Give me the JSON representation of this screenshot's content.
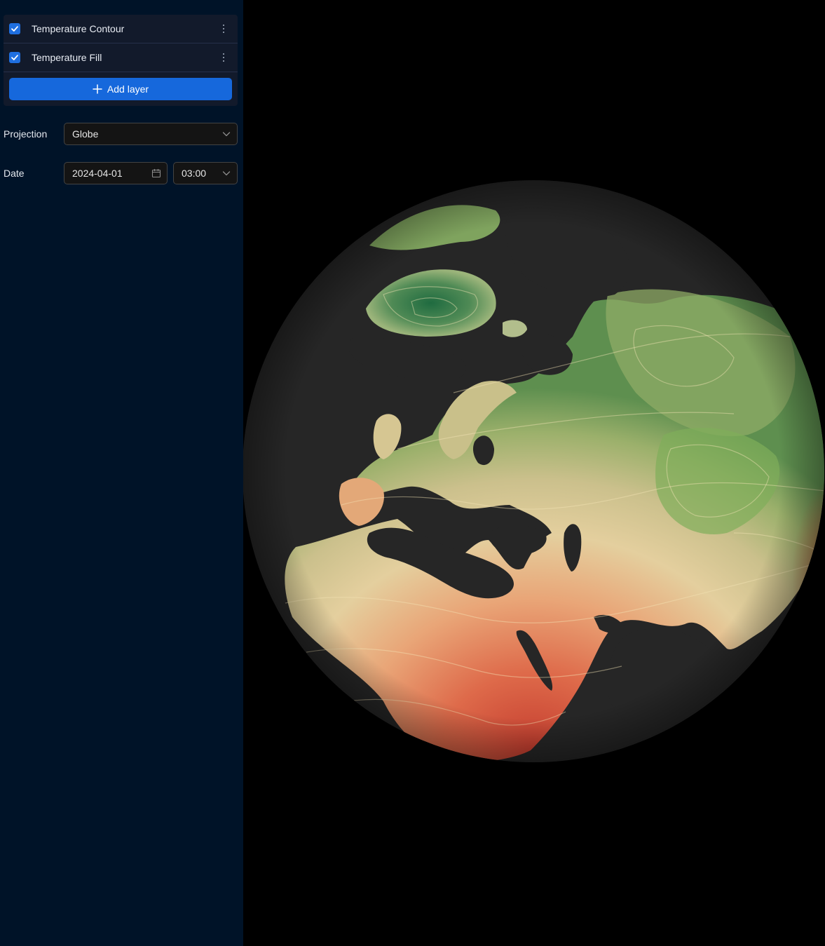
{
  "layers": {
    "items": [
      {
        "label": "Temperature Contour",
        "checked": true
      },
      {
        "label": "Temperature Fill",
        "checked": true
      }
    ],
    "add_label": "Add layer"
  },
  "projection": {
    "label": "Projection",
    "value": "Globe"
  },
  "date": {
    "label": "Date",
    "value": "2024-04-01",
    "time": "03:00"
  },
  "colors": {
    "sidebar_bg": "#001328",
    "accent": "#1668dc",
    "ocean": "#262626",
    "cold": "#2f7a4a",
    "mild": "#d9cfa0",
    "warm": "#e07a52",
    "hot": "#c43c2e"
  }
}
